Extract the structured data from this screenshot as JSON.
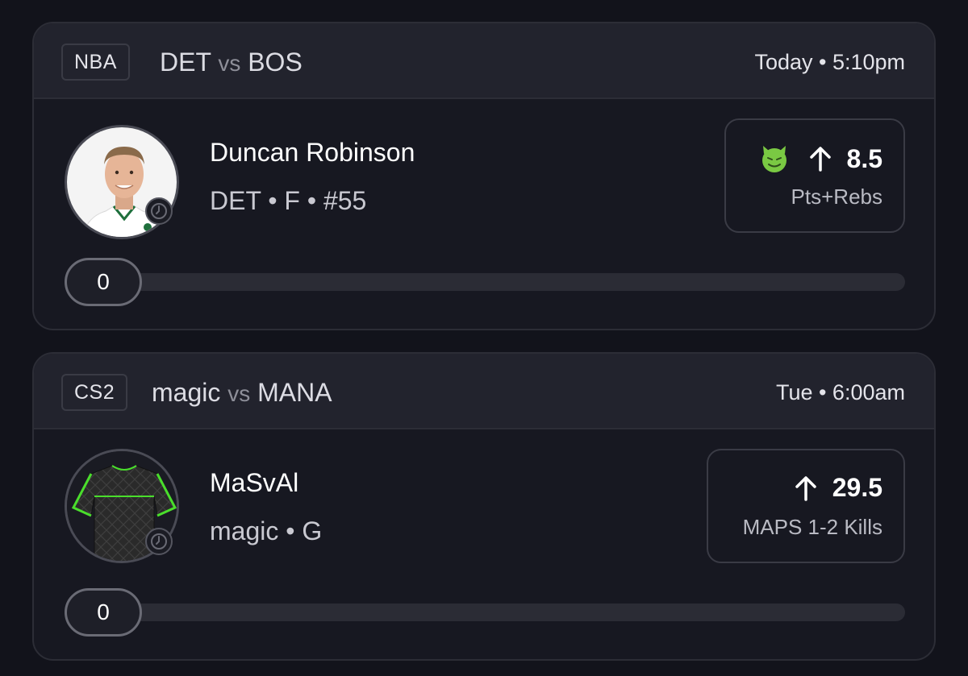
{
  "cards": [
    {
      "league": "NBA",
      "team_a": "DET",
      "vs": "vs",
      "team_b": "BOS",
      "time": "Today • 5:10pm",
      "player_name": "Duncan Robinson",
      "player_meta": "DET • F • #55",
      "line_value": "8.5",
      "line_stat": "Pts+Rebs",
      "progress_value": "0",
      "progress_fraction": 0,
      "badge_icon": "devil-emoji-icon",
      "badge_color": "#7ac943"
    },
    {
      "league": "CS2",
      "team_a": "magic",
      "vs": "vs",
      "team_b": "MANA",
      "time": "Tue • 6:00am",
      "player_name": "MaSvAl",
      "player_meta": "magic • G",
      "line_value": "29.5",
      "line_stat": "MAPS 1-2 Kills",
      "progress_value": "0",
      "progress_fraction": 0
    }
  ],
  "colors": {
    "background": "#12131b",
    "card": "#171821",
    "header": "#22232d",
    "jersey_accent": "#4ade2c"
  }
}
